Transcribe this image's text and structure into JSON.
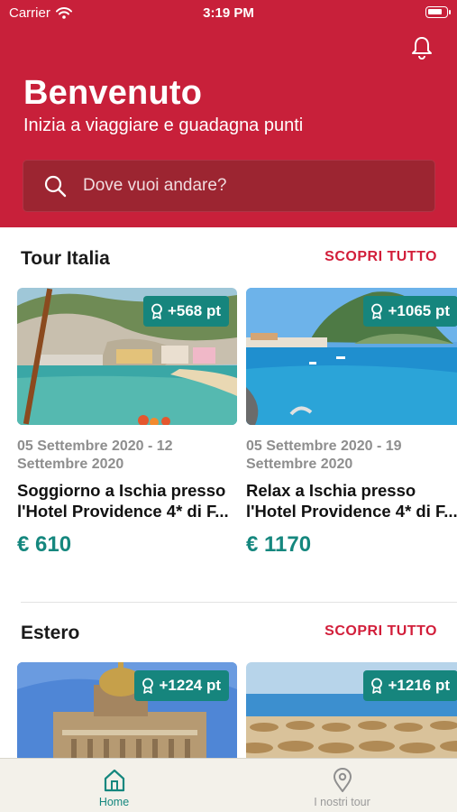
{
  "status_bar": {
    "carrier": "Carrier",
    "time": "3:19 PM",
    "battery_level": 0.85
  },
  "header": {
    "title": "Benvenuto",
    "subtitle": "Inizia a viaggiare e guadagna punti",
    "search_placeholder": "Dove vuoi andare?",
    "notification_icon": "bell-icon"
  },
  "sections": [
    {
      "title": "Tour Italia",
      "see_all": "SCOPRI TUTTO",
      "cards": [
        {
          "points": "+568 pt",
          "dates": "05 Settembre 2020 - 12 Settembre 2020",
          "title_line1": "Soggiorno a Ischia presso",
          "title_line2": "l'Hotel Providence 4* di F...",
          "price": "€ 610"
        },
        {
          "points": "+1065 pt",
          "dates": "05 Settembre 2020 - 19 Settembre 2020",
          "title_line1": "Relax a Ischia presso",
          "title_line2": "l'Hotel Providence 4* di F...",
          "price": "€ 1170"
        }
      ]
    },
    {
      "title": "Estero",
      "see_all": "SCOPRI TUTTO",
      "cards": [
        {
          "points": "+1224 pt"
        },
        {
          "points": "+1216 pt"
        }
      ]
    }
  ],
  "tabbar": {
    "items": [
      {
        "label": "Home",
        "icon": "home-icon",
        "active": true
      },
      {
        "label": "I nostri tour",
        "icon": "map-pin-icon",
        "active": false
      }
    ]
  },
  "colors": {
    "brand": "#c8203a",
    "accent": "#16857d",
    "see_all": "#d21e3a",
    "price": "#15877e"
  }
}
